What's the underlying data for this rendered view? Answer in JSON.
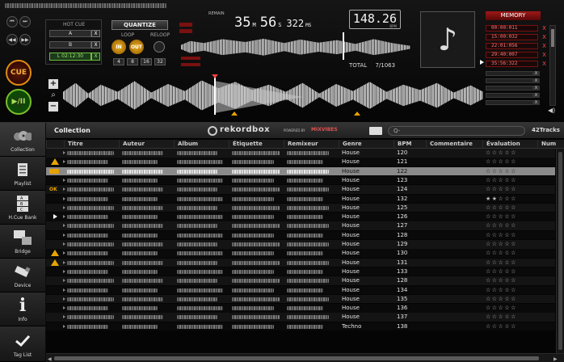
{
  "deck": {
    "hot_cue_label": "HOT CUE",
    "hot_cue_a": "A",
    "hot_cue_b": "B",
    "loop_time": "L 02:12:30",
    "loop_x": "X",
    "quantize_label": "QUANTIZE",
    "loop_label": "LOOP",
    "reloop_label": "RELOOP",
    "loop_in": "IN",
    "loop_out": "OUT",
    "beat_sizes": [
      "4",
      "8",
      "16",
      "32"
    ],
    "remain_label": "REMAIN",
    "time_min": "35",
    "time_min_unit": "M",
    "time_sec": "56",
    "time_sec_unit": "S",
    "time_ms": "322",
    "time_ms_unit": "MS",
    "bpm": "148.26",
    "bpm_unit": "BPM",
    "total_label": "TOTAL",
    "total_value": "7/1063",
    "cue_label": "CUE",
    "play_label": "▶/II",
    "memory_label": "MEMORY",
    "memory_cues": [
      "00:00:011",
      "15:00:032",
      "22:01:056",
      "29:40:007",
      "35:56:322"
    ],
    "memory_x": "X"
  },
  "sidebar": {
    "items": [
      {
        "label": "Collection"
      },
      {
        "label": "Playlist"
      },
      {
        "label": "H.Cue Bank"
      },
      {
        "label": "Bridge"
      },
      {
        "label": "Device"
      },
      {
        "label": "Info"
      },
      {
        "label": "Tag List"
      }
    ]
  },
  "browser": {
    "title": "Collection",
    "logo_text": "rekordbox",
    "powered_by": "POWERED BY",
    "mixvibes": "MIXVIBES",
    "search_placeholder": "Q-",
    "track_count": "42Tracks",
    "columns": [
      "Titre",
      "Auteur",
      "Album",
      "Étiquette",
      "Remixeur",
      "Genre",
      "BPM",
      "Commentaire",
      "Évaluation",
      "Num"
    ],
    "rows": [
      {
        "genre": "House",
        "bpm": "120",
        "stars": "☆☆☆☆☆",
        "mark": ""
      },
      {
        "genre": "House",
        "bpm": "121",
        "stars": "☆☆☆☆☆",
        "mark": "warn"
      },
      {
        "genre": "House",
        "bpm": "122",
        "stars": "☆☆☆☆☆",
        "mark": "sel"
      },
      {
        "genre": "House",
        "bpm": "123",
        "stars": "☆☆☆☆☆",
        "mark": ""
      },
      {
        "genre": "House",
        "bpm": "124",
        "stars": "☆☆☆☆☆",
        "mark": "ok"
      },
      {
        "genre": "House",
        "bpm": "132",
        "stars": "★★☆☆☆",
        "mark": ""
      },
      {
        "genre": "House",
        "bpm": "125",
        "stars": "☆☆☆☆☆",
        "mark": ""
      },
      {
        "genre": "House",
        "bpm": "126",
        "stars": "☆☆☆☆☆",
        "mark": "play"
      },
      {
        "genre": "House",
        "bpm": "127",
        "stars": "☆☆☆☆☆",
        "mark": ""
      },
      {
        "genre": "House",
        "bpm": "128",
        "stars": "☆☆☆☆☆",
        "mark": ""
      },
      {
        "genre": "House",
        "bpm": "129",
        "stars": "☆☆☆☆☆",
        "mark": ""
      },
      {
        "genre": "House",
        "bpm": "130",
        "stars": "☆☆☆☆☆",
        "mark": "warn"
      },
      {
        "genre": "House",
        "bpm": "131",
        "stars": "☆☆☆☆☆",
        "mark": "warn"
      },
      {
        "genre": "House",
        "bpm": "133",
        "stars": "☆☆☆☆☆",
        "mark": ""
      },
      {
        "genre": "House",
        "bpm": "128",
        "stars": "☆☆☆☆☆",
        "mark": ""
      },
      {
        "genre": "House",
        "bpm": "134",
        "stars": "☆☆☆☆☆",
        "mark": ""
      },
      {
        "genre": "House",
        "bpm": "135",
        "stars": "☆☆☆☆☆",
        "mark": ""
      },
      {
        "genre": "House",
        "bpm": "136",
        "stars": "☆☆☆☆☆",
        "mark": ""
      },
      {
        "genre": "House",
        "bpm": "137",
        "stars": "☆☆☆☆☆",
        "mark": ""
      },
      {
        "genre": "Techno",
        "bpm": "138",
        "stars": "☆☆☆☆☆",
        "mark": ""
      }
    ]
  },
  "colors": {
    "accent": "#e8a200",
    "cue_red": "#cc2222",
    "memory_red": "#ff4a4a",
    "play_green": "#88cc33"
  }
}
